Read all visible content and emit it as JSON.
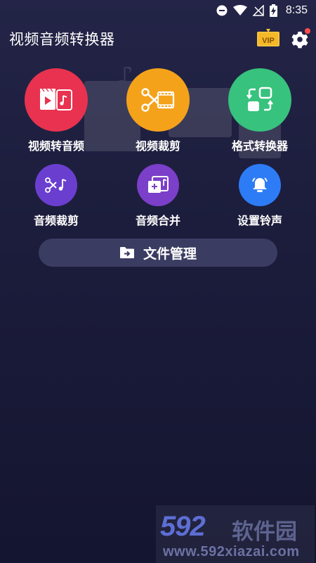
{
  "status_bar": {
    "time": "8:35",
    "icons": [
      "do-not-disturb-icon",
      "wifi-icon",
      "no-signal-icon",
      "battery-charging-icon"
    ]
  },
  "app_bar": {
    "title": "视频音频转换器",
    "vip_label": "VIP",
    "vip_icon": "vip-crown-icon",
    "settings_icon": "gear-icon",
    "notification_dot_color": "#ff4d4d"
  },
  "features": {
    "video_to_audio": {
      "label": "视频转音频",
      "icon": "video-to-audio-icon",
      "color": "#e8324f"
    },
    "video_trim": {
      "label": "视频裁剪",
      "icon": "video-scissors-icon",
      "color": "#f5a21b"
    },
    "format_converter": {
      "label": "格式转换器",
      "icon": "convert-format-icon",
      "color": "#37c27d"
    },
    "audio_trim": {
      "label": "音频裁剪",
      "icon": "audio-scissors-icon",
      "color": "#6a3fd0"
    },
    "audio_merge": {
      "label": "音频合并",
      "icon": "audio-merge-icon",
      "color": "#7b3fc9"
    },
    "ringtone": {
      "label": "设置铃声",
      "icon": "bell-icon",
      "color": "#2d7cf6"
    }
  },
  "file_manager": {
    "label": "文件管理",
    "icon": "folder-arrow-icon"
  },
  "watermark": {
    "brand": "592",
    "brand_cn": "软件园",
    "url": "www.592xiazai.com"
  }
}
